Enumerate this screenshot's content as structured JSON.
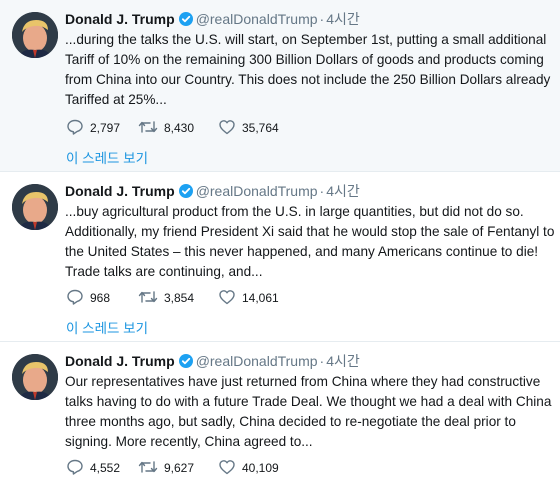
{
  "colors": {
    "text": "#14171a",
    "secondary": "#657786",
    "link": "#1b95e0",
    "verified": "#1da1f2",
    "selected_bg": "#f5f8fa"
  },
  "tweets": [
    {
      "name": "Donald J. Trump",
      "handle": "@realDonaldTrump",
      "separator": "·",
      "time": "4시간",
      "lines": [
        "...during the talks the U.S. will start, on September 1st, putting a small additional",
        "Tariff of 10% on the remaining 300 Billion Dollars of goods and products coming",
        "from China into our Country. This does not include the 250 Billion Dollars already",
        "Tariffed at 25%..."
      ],
      "replies": "2,797",
      "retweets": "8,430",
      "likes": "35,764",
      "show_thread": "이 스레드 보기"
    },
    {
      "name": "Donald J. Trump",
      "handle": "@realDonaldTrump",
      "separator": "·",
      "time": "4시간",
      "lines": [
        "...buy agricultural product from the U.S. in large quantities, but did not do so.",
        "Additionally, my friend President Xi said that he would stop the sale of Fentanyl to",
        "the United States – this never happened, and many Americans continue to die!",
        "Trade talks are continuing, and..."
      ],
      "replies": "968",
      "retweets": "3,854",
      "likes": "14,061",
      "show_thread": "이 스레드 보기"
    },
    {
      "name": "Donald J. Trump",
      "handle": "@realDonaldTrump",
      "separator": "·",
      "time": "4시간",
      "lines": [
        "Our representatives have just returned from China where they had constructive",
        "talks having to do with a future Trade Deal. We thought we had a deal with China",
        "three months ago, but sadly, China decided to re-negotiate the deal prior to",
        "signing. More recently, China agreed to..."
      ],
      "replies": "4,552",
      "retweets": "9,627",
      "likes": "40,109"
    }
  ]
}
